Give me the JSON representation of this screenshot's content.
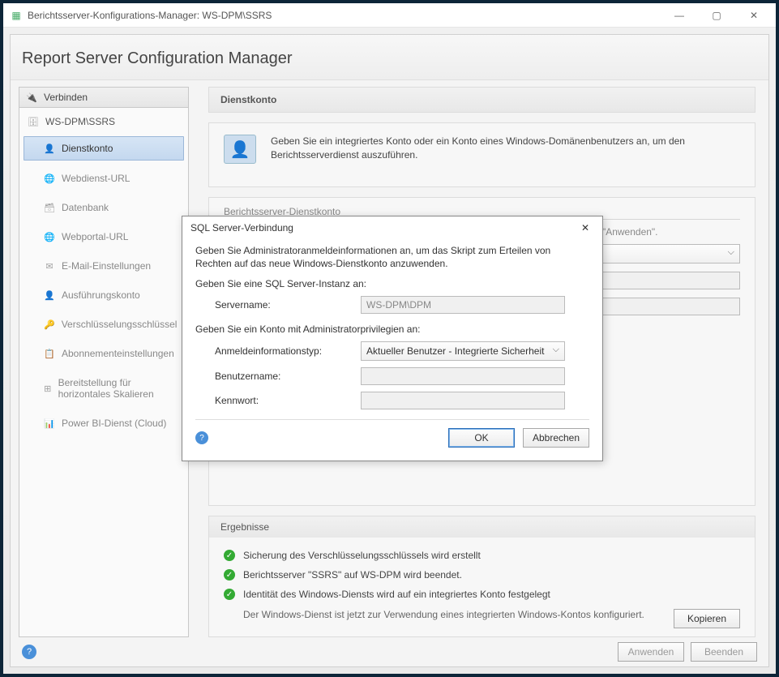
{
  "titlebar": {
    "title": "Berichtsserver-Konfigurations-Manager: WS-DPM\\SSRS"
  },
  "banner": {
    "title": "Report Server Configuration Manager"
  },
  "sidebar": {
    "header": "Verbinden",
    "root": "WS-DPM\\SSRS",
    "items": [
      {
        "label": "Dienstkonto",
        "selected": true
      },
      {
        "label": "Webdienst-URL"
      },
      {
        "label": "Datenbank"
      },
      {
        "label": "Webportal-URL"
      },
      {
        "label": "E-Mail-Einstellungen"
      },
      {
        "label": "Ausführungskonto"
      },
      {
        "label": "Verschlüsselungsschlüssel"
      },
      {
        "label": "Abonnementeinstellungen"
      },
      {
        "label": "Bereitstellung für horizontales Skalieren"
      },
      {
        "label": "Power BI-Dienst (Cloud)"
      }
    ]
  },
  "content": {
    "title": "Dienstkonto",
    "intro": "Geben Sie ein integriertes Konto oder ein Konto eines Windows-Domänenbenutzers an, um den Berichtsserverdienst auszuführen.",
    "fieldset": {
      "legend": "Berichtsserver-Dienstkonto",
      "desc": "Wählen Sie eine Option zum Festlegen des Dienstkontos aus, und klicken Sie dann auf \"Anwenden\"."
    }
  },
  "results": {
    "title": "Ergebnisse",
    "items": [
      "Sicherung des Verschlüsselungsschlüssels wird erstellt",
      "Berichtsserver \"SSRS\" auf WS-DPM wird beendet.",
      "Identität des Windows-Diensts wird auf ein integriertes Konto festgelegt"
    ],
    "sub": "Der Windows-Dienst ist jetzt zur Verwendung eines integrierten Windows-Kontos konfiguriert.",
    "copy": "Kopieren"
  },
  "footer": {
    "apply": "Anwenden",
    "exit": "Beenden"
  },
  "dialog": {
    "title": "SQL Server-Verbindung",
    "desc": "Geben Sie Administratoranmeldeinformationen an, um das Skript zum Erteilen von Rechten auf das neue Windows-Dienstkonto anzuwenden.",
    "section1": "Geben Sie eine SQL Server-Instanz an:",
    "servername_label": "Servername:",
    "servername": "WS-DPM\\DPM",
    "section2": "Geben Sie ein Konto mit Administratorprivilegien an:",
    "credtype_label": "Anmeldeinformationstyp:",
    "credtype": "Aktueller Benutzer - Integrierte Sicherheit",
    "user_label": "Benutzername:",
    "pass_label": "Kennwort:",
    "ok": "OK",
    "cancel": "Abbrechen"
  }
}
